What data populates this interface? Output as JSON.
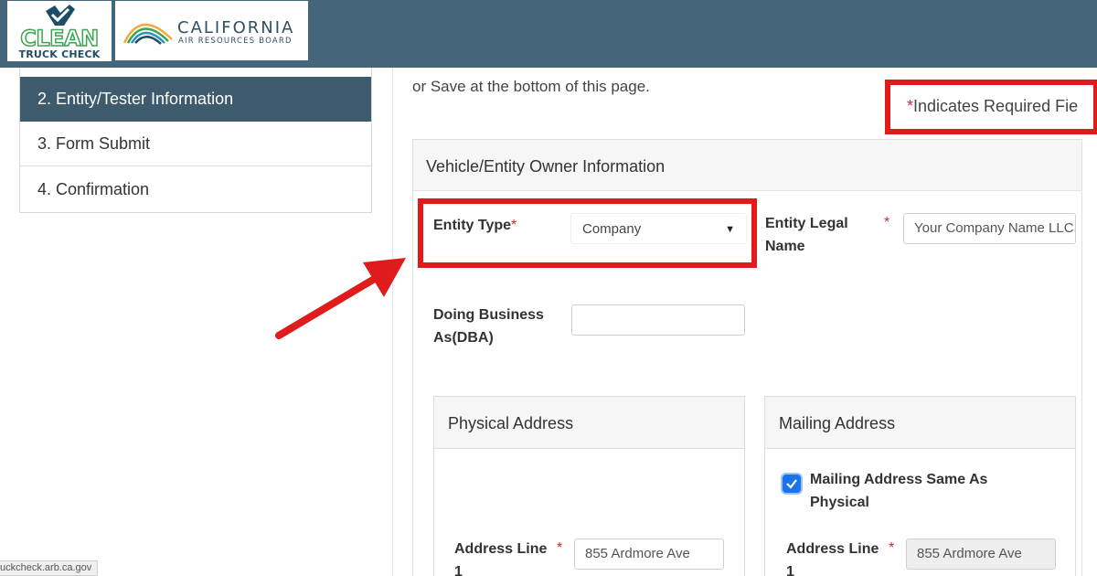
{
  "header": {
    "clean_truck_logo": {
      "word": "CLEAN",
      "subtitle": "TRUCK CHECK"
    },
    "carb_logo": {
      "title": "CALIFORNIA",
      "subtitle": "AIR RESOURCES BOARD"
    },
    "bar_color": "#44657a"
  },
  "sidebar": {
    "items": [
      {
        "label": "2. Entity/Tester Information",
        "active": true
      },
      {
        "label": "3. Form Submit",
        "active": false
      },
      {
        "label": "4. Confirmation",
        "active": false
      }
    ]
  },
  "intro_text": "or Save at the bottom of this page.",
  "required_note": {
    "star": "*",
    "text": "Indicates Required Fie"
  },
  "owner_panel": {
    "title": "Vehicle/Entity Owner Information",
    "entity_type": {
      "label": "Entity Type",
      "star": "*",
      "value": "Company"
    },
    "entity_legal_name": {
      "label_line1": "Entity Legal",
      "label_line2": "Name",
      "star": "*",
      "value": "Your Company Name LLC"
    },
    "dba": {
      "label_line1": "Doing Business",
      "label_line2": "As(DBA)",
      "value": ""
    }
  },
  "physical_address": {
    "title": "Physical Address",
    "address_line1": {
      "label_line1": "Address Line",
      "label_line2": "1",
      "star": "*",
      "value": "855 Ardmore Ave"
    }
  },
  "mailing_address": {
    "title": "Mailing Address",
    "same_as_physical": {
      "label_line1": "Mailing Address Same As",
      "label_line2": "Physical",
      "checked": true
    },
    "address_line1": {
      "label_line1": "Address Line",
      "label_line2": "1",
      "star": "*",
      "value": "855 Ardmore Ave"
    }
  },
  "status_bar": "uckcheck.arb.ca.gov",
  "colors": {
    "highlight": "#e01b1b",
    "required_star": "#d9262b",
    "active_nav": "#3d5b6c",
    "checkbox": "#1a73e8"
  },
  "icons": [
    "chevron-down-icon",
    "checkmark-icon",
    "arrow-icon"
  ]
}
